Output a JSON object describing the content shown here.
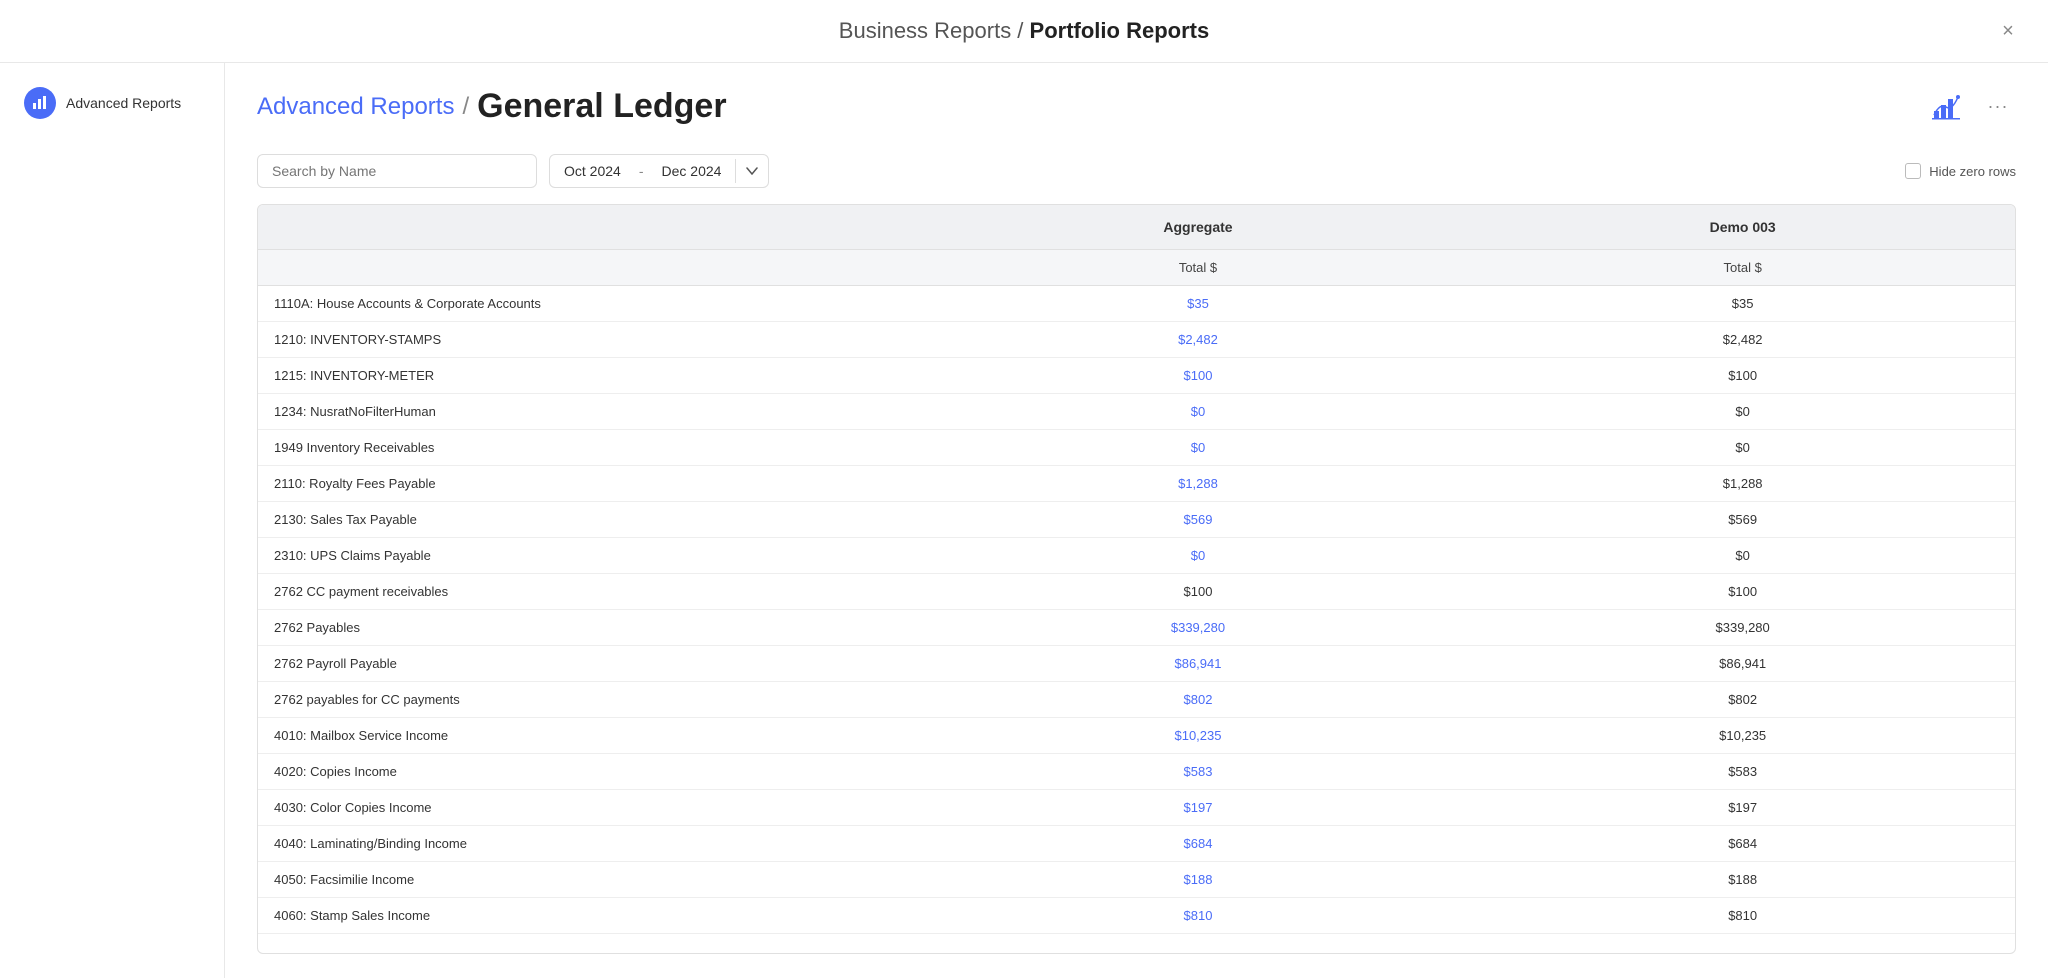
{
  "window": {
    "title_prefix": "Business Reports /",
    "title_bold": "Portfolio Reports",
    "close_label": "×"
  },
  "sidebar": {
    "items": [
      {
        "id": "advanced-reports",
        "label": "Advanced Reports",
        "icon": "chart-icon"
      }
    ]
  },
  "breadcrumb": {
    "link_label": "Advanced Reports",
    "separator": "/",
    "current": "General Ledger"
  },
  "header_actions": {
    "more_dots": "···"
  },
  "filters": {
    "search_placeholder": "Search by Name",
    "date_start": "Oct 2024",
    "date_separator": "-",
    "date_end": "Dec 2024",
    "hide_zero_label": "Hide zero rows"
  },
  "table": {
    "columns": [
      {
        "id": "name",
        "label": "",
        "sublabel": ""
      },
      {
        "id": "aggregate",
        "label": "Aggregate",
        "sublabel": "Total $"
      },
      {
        "id": "demo003",
        "label": "Demo 003",
        "sublabel": "Total $"
      }
    ],
    "rows": [
      {
        "name": "1110A: House Accounts & Corporate Accounts",
        "aggregate": "$35",
        "agg_link": true,
        "demo003": "$35",
        "demo_link": false
      },
      {
        "name": "1210: INVENTORY-STAMPS",
        "aggregate": "$2,482",
        "agg_link": true,
        "demo003": "$2,482",
        "demo_link": false
      },
      {
        "name": "1215: INVENTORY-METER",
        "aggregate": "$100",
        "agg_link": true,
        "demo003": "$100",
        "demo_link": false
      },
      {
        "name": "1234: NusratNoFilterHuman",
        "aggregate": "$0",
        "agg_link": true,
        "demo003": "$0",
        "demo_link": false
      },
      {
        "name": "1949 Inventory Receivables",
        "aggregate": "$0",
        "agg_link": true,
        "demo003": "$0",
        "demo_link": false
      },
      {
        "name": "2110: Royalty Fees Payable",
        "aggregate": "$1,288",
        "agg_link": true,
        "demo003": "$1,288",
        "demo_link": false
      },
      {
        "name": "2130: Sales Tax Payable",
        "aggregate": "$569",
        "agg_link": true,
        "demo003": "$569",
        "demo_link": false
      },
      {
        "name": "2310: UPS Claims Payable",
        "aggregate": "$0",
        "agg_link": true,
        "demo003": "$0",
        "demo_link": false
      },
      {
        "name": "2762 CC payment receivables",
        "aggregate": "$100",
        "agg_link": false,
        "demo003": "$100",
        "demo_link": false
      },
      {
        "name": "2762 Payables",
        "aggregate": "$339,280",
        "agg_link": true,
        "demo003": "$339,280",
        "demo_link": false
      },
      {
        "name": "2762 Payroll Payable",
        "aggregate": "$86,941",
        "agg_link": true,
        "demo003": "$86,941",
        "demo_link": false
      },
      {
        "name": "2762 payables for CC payments",
        "aggregate": "$802",
        "agg_link": true,
        "demo003": "$802",
        "demo_link": false
      },
      {
        "name": "4010: Mailbox Service Income",
        "aggregate": "$10,235",
        "agg_link": true,
        "demo003": "$10,235",
        "demo_link": false
      },
      {
        "name": "4020: Copies Income",
        "aggregate": "$583",
        "agg_link": true,
        "demo003": "$583",
        "demo_link": false
      },
      {
        "name": "4030: Color Copies Income",
        "aggregate": "$197",
        "agg_link": true,
        "demo003": "$197",
        "demo_link": false
      },
      {
        "name": "4040: Laminating/Binding Income",
        "aggregate": "$684",
        "agg_link": true,
        "demo003": "$684",
        "demo_link": false
      },
      {
        "name": "4050: Facsimilie Income",
        "aggregate": "$188",
        "agg_link": true,
        "demo003": "$188",
        "demo_link": false
      },
      {
        "name": "4060: Stamp Sales Income",
        "aggregate": "$810",
        "agg_link": true,
        "demo003": "$810",
        "demo_link": false
      }
    ]
  }
}
